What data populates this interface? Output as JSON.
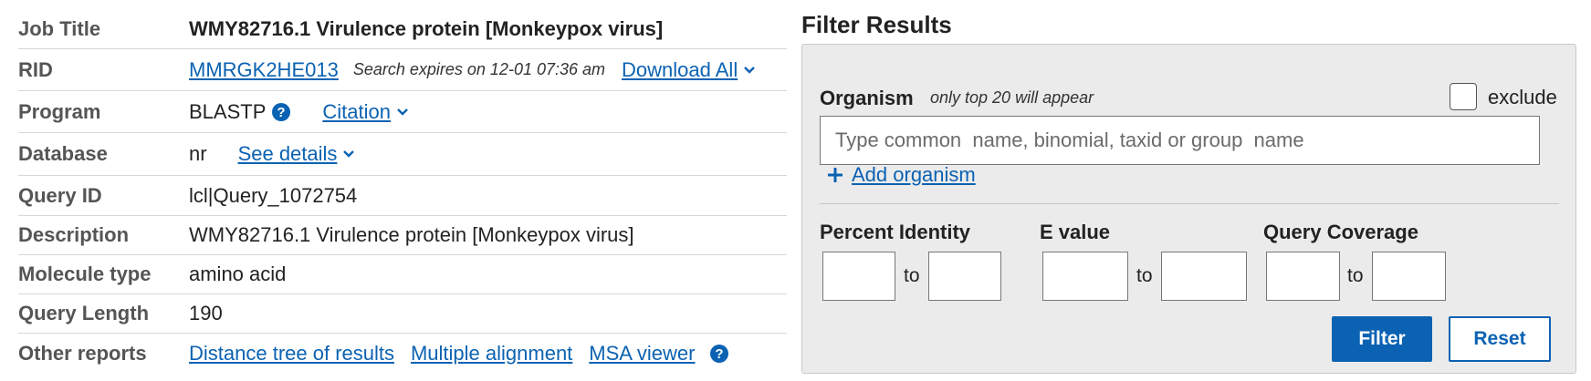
{
  "summary": {
    "job_title": {
      "label": "Job Title",
      "value": "WMY82716.1 Virulence protein [Monkeypox virus]"
    },
    "rid": {
      "label": "RID",
      "value": "MMRGK2HE013",
      "expires": "Search expires on 12-01 07:36 am",
      "download": "Download All"
    },
    "program": {
      "label": "Program",
      "value": "BLASTP",
      "citation": "Citation"
    },
    "database": {
      "label": "Database",
      "value": "nr",
      "details": "See details"
    },
    "query_id": {
      "label": "Query ID",
      "value": "lcl|Query_1072754"
    },
    "description": {
      "label": "Description",
      "value": "WMY82716.1 Virulence protein [Monkeypox virus]"
    },
    "molecule_type": {
      "label": "Molecule type",
      "value": "amino acid"
    },
    "query_length": {
      "label": "Query Length",
      "value": "190"
    },
    "other_reports": {
      "label": "Other reports",
      "links": [
        "Distance tree of results",
        "Multiple alignment",
        "MSA viewer"
      ]
    }
  },
  "filter": {
    "title": "Filter Results",
    "organism_label": "Organism",
    "organism_hint": "only top 20 will appear",
    "exclude_label": "exclude",
    "organism_placeholder": "Type common  name, binomial, taxid or group  name",
    "add_organism": "Add organism",
    "percent_identity_label": "Percent Identity",
    "evalue_label": "E value",
    "query_coverage_label": "Query Coverage",
    "to_label": "to",
    "filter_button": "Filter",
    "reset_button": "Reset"
  },
  "colors": {
    "link": "#0b62b2",
    "panel_bg": "#ebebeb",
    "button": "#0b62b2"
  }
}
